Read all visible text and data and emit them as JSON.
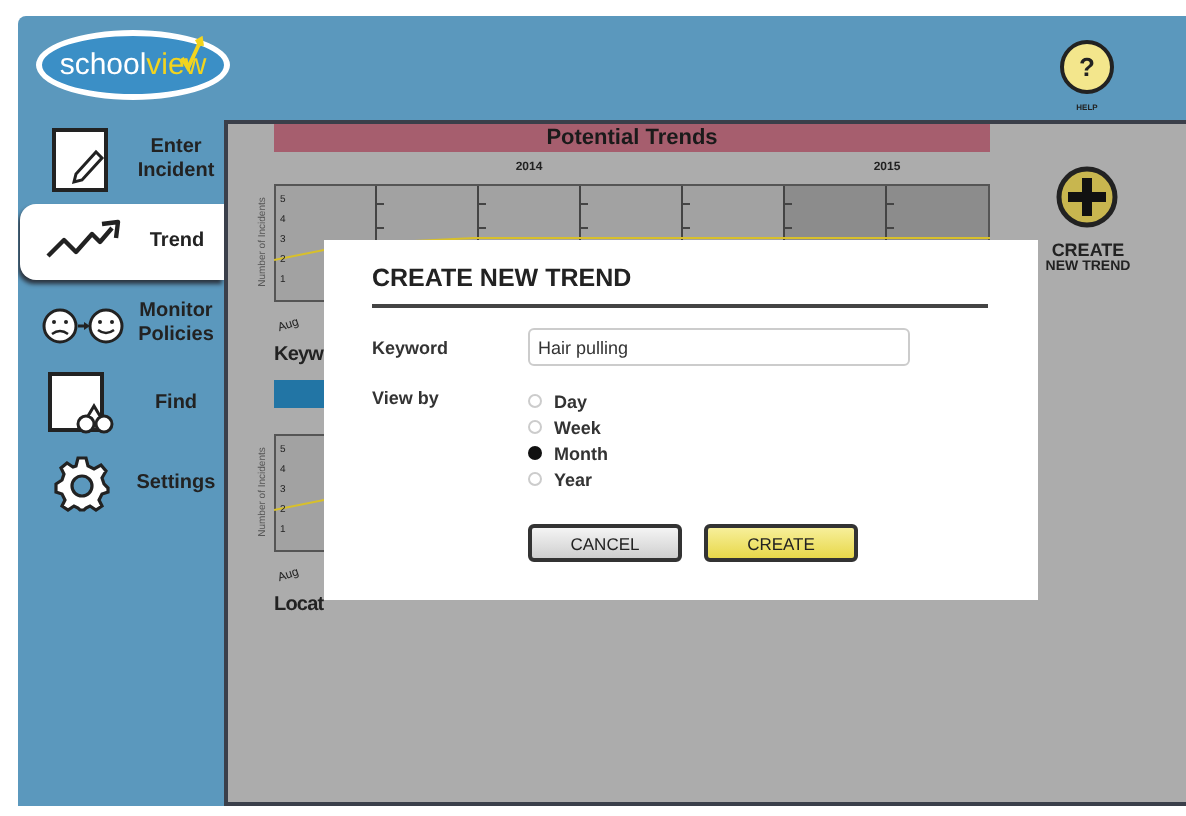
{
  "header": {
    "logo": {
      "part_1": "school",
      "part_2": "view"
    },
    "help": {
      "symbol": "?",
      "label": "HELP"
    }
  },
  "sidebar": {
    "items": [
      {
        "label": "Enter Incident",
        "kind": "enter",
        "selected": false
      },
      {
        "label": "Trend",
        "kind": "trend",
        "selected": true
      },
      {
        "label": "Monitor Policies",
        "kind": "monitor",
        "selected": false
      },
      {
        "label": "Find",
        "kind": "find",
        "selected": false
      },
      {
        "label": "Settings",
        "kind": "settings",
        "selected": false
      }
    ]
  },
  "content": {
    "title": "Potential Trends",
    "charts": [
      {
        "years": [
          "2014",
          "2015"
        ],
        "y_axis_label": "Number of Incidents",
        "y_ticks": [
          "5",
          "4",
          "3",
          "2",
          "1"
        ],
        "x_start": "Aug",
        "heading": "Keyw",
        "bar": true
      },
      {
        "y_axis_label": "Number of Incidents",
        "y_ticks": [
          "5",
          "4",
          "3",
          "2",
          "1"
        ],
        "x_start": "Aug",
        "heading": "Locat",
        "bar": false
      }
    ],
    "create_trend": {
      "line_1": "CREATE",
      "line_2": "NEW TREND"
    }
  },
  "dialog": {
    "title": "CREATE NEW TREND",
    "keyword": {
      "label": "Keyword",
      "value": "Hair pulling"
    },
    "view_by": {
      "label": "View by",
      "options": [
        {
          "label": "Day",
          "selected": false
        },
        {
          "label": "Week",
          "selected": false
        },
        {
          "label": "Month",
          "selected": true
        },
        {
          "label": "Year",
          "selected": false
        }
      ]
    },
    "buttons": [
      {
        "label": "CANCEL",
        "kind": "secondary"
      },
      {
        "label": "CREATE",
        "kind": "primary"
      }
    ]
  }
}
